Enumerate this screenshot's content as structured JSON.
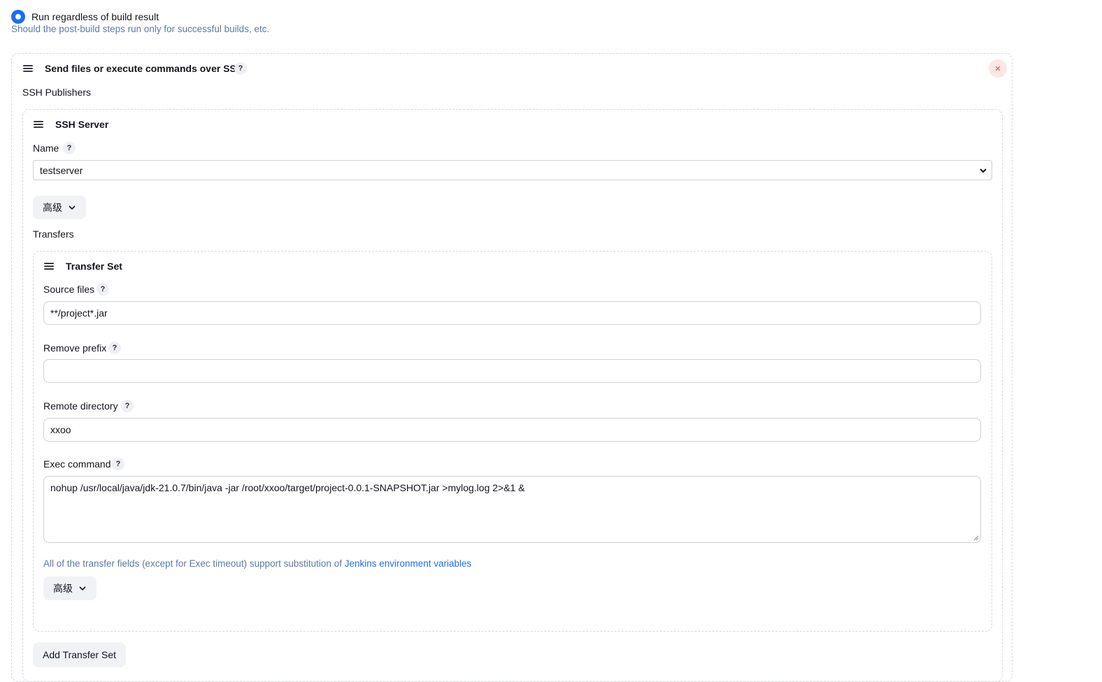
{
  "post_build": {
    "radio_label": "Run regardless of build result",
    "hint": "Should the post-build steps run only for successful builds, etc."
  },
  "ssh_step": {
    "title": "Send files or execute commands over SSH",
    "help": "?",
    "close": "×",
    "publishers_label": "SSH Publishers"
  },
  "ssh_server": {
    "title": "SSH Server",
    "name_label": "Name",
    "name_help": "?",
    "name_value": "testserver",
    "advanced_label": "高级",
    "transfers_label": "Transfers"
  },
  "transfer_set": {
    "title": "Transfer Set",
    "source_files_label": "Source files",
    "source_files_value": "**/project*.jar",
    "remove_prefix_label": "Remove prefix",
    "remove_prefix_value": "",
    "remote_directory_label": "Remote directory",
    "remote_directory_value": "xxoo",
    "exec_command_label": "Exec command",
    "exec_command_value": "nohup /usr/local/java/jdk-21.0.7/bin/java -jar /root/xxoo/target/project-0.0.1-SNAPSHOT.jar >mylog.log 2>&1 &",
    "help": "?",
    "env_note_prefix": "All of the transfer fields (except for Exec timeout) support substitution of ",
    "env_note_link": "Jenkins environment variables",
    "advanced_label": "高级"
  },
  "add_transfer_set_label": "Add Transfer Set",
  "colors": {
    "accent": "#1a6ef5",
    "hint_text": "#5a7aa5",
    "close_bg": "#fde6e6",
    "close_fg": "#e5484d"
  }
}
